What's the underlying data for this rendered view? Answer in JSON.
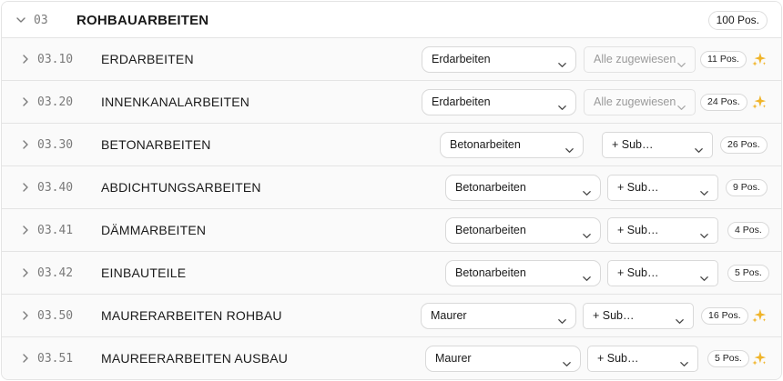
{
  "group": {
    "code": "03",
    "title": "ROHBAUARBEITEN",
    "count": "100 Pos."
  },
  "colors": {
    "sparkle": "#f0b429",
    "border": "#e4e4e4"
  },
  "rows": [
    {
      "code": "03.10",
      "title": "ERDARBEITEN",
      "trade": "Erdarbeiten",
      "sub": "Alle zugewiesen",
      "sub_disabled": true,
      "count": "11 Pos.",
      "sparkle": true
    },
    {
      "code": "03.20",
      "title": "INNENKANALARBEITEN",
      "trade": "Erdarbeiten",
      "sub": "Alle zugewiesen",
      "sub_disabled": true,
      "count": "24 Pos.",
      "sparkle": true
    },
    {
      "code": "03.30",
      "title": "BETONARBEITEN",
      "trade": "Betonarbeiten",
      "sub": "+ Sub…",
      "sub_disabled": false,
      "count": "26 Pos.",
      "sparkle": false
    },
    {
      "code": "03.40",
      "title": "ABDICHTUNGSARBEITEN",
      "trade": "Betonarbeiten",
      "sub": "+ Sub…",
      "sub_disabled": false,
      "count": "9 Pos.",
      "sparkle": false
    },
    {
      "code": "03.41",
      "title": "DÄMMARBEITEN",
      "trade": "Betonarbeiten",
      "sub": "+ Sub…",
      "sub_disabled": false,
      "count": "4 Pos.",
      "sparkle": false
    },
    {
      "code": "03.42",
      "title": "EINBAUTEILE",
      "trade": "Betonarbeiten",
      "sub": "+ Sub…",
      "sub_disabled": false,
      "count": "5 Pos.",
      "sparkle": false
    },
    {
      "code": "03.50",
      "title": "MAURERARBEITEN ROHBAU",
      "trade": "Maurer",
      "sub": "+ Sub…",
      "sub_disabled": false,
      "count": "16 Pos.",
      "sparkle": true
    },
    {
      "code": "03.51",
      "title": "MAUREERARBEITEN AUSBAU",
      "trade": "Maurer",
      "sub": "+ Sub…",
      "sub_disabled": false,
      "count": "5 Pos.",
      "sparkle": true
    }
  ]
}
